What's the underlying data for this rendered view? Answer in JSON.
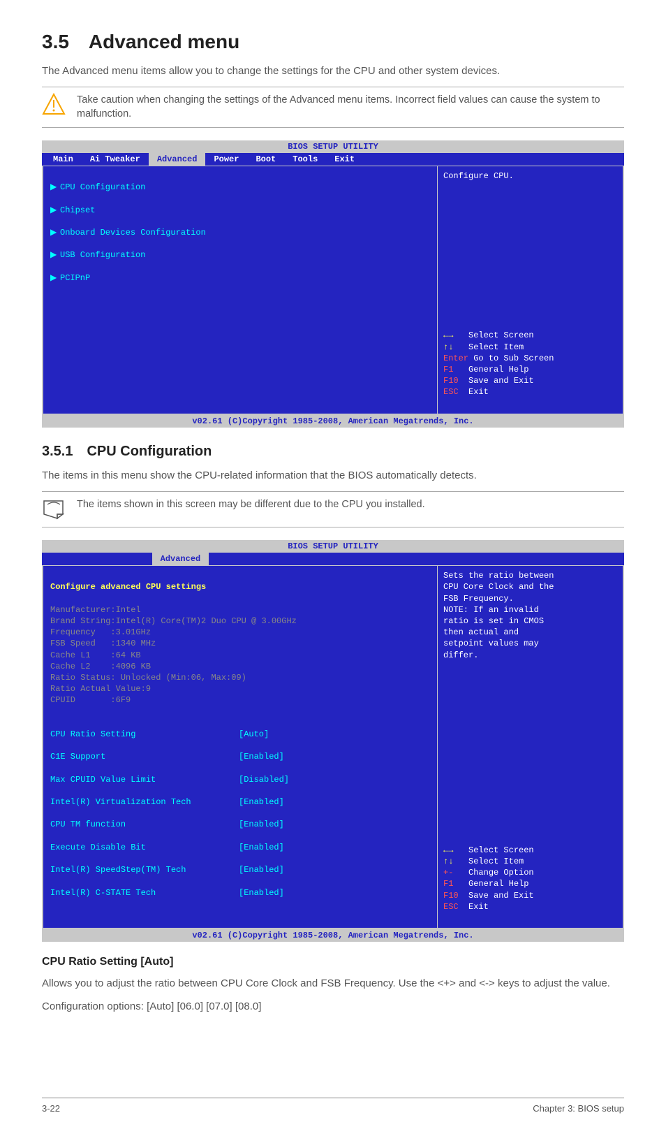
{
  "section_title": "3.5 Advanced menu",
  "intro_text": "The Advanced menu items allow you to change the settings for the CPU and other system devices.",
  "callout1": "Take caution when changing the settings of the Advanced menu items. Incorrect field values can cause the system to malfunction.",
  "bios_header": "BIOS SETUP UTILITY",
  "tabs": {
    "main": "Main",
    "ai": "Ai Tweaker",
    "advanced": "Advanced",
    "power": "Power",
    "boot": "Boot",
    "tools": "Tools",
    "exit": "Exit"
  },
  "menu1_items": {
    "i1": "CPU Configuration",
    "i2": "Chipset",
    "i3": "Onboard Devices Configuration",
    "i4": "USB Configuration",
    "i5": "PCIPnP"
  },
  "menu1_help": "Configure CPU.",
  "keys": {
    "select_screen": "Select Screen",
    "select_item": "Select Item",
    "sub_screen": "Go to Sub Screen",
    "general_help": "General Help",
    "save_exit": "Save and Exit",
    "exit": "Exit",
    "change_option": "Change Option",
    "arrows_lr": "←→",
    "arrows_ud": "↑↓",
    "enter": "Enter",
    "plus_minus": "+-",
    "f1": "F1",
    "f10": "F10",
    "esc": "ESC"
  },
  "bios_footer": "v02.61 (C)Copyright 1985-2008, American Megatrends, Inc.",
  "subsection_title": "3.5.1 CPU Configuration",
  "sub_text": "The items in this menu show the CPU-related information that the BIOS automatically detects.",
  "callout2": "The items shown in this screen may be different due to the CPU you installed.",
  "cpu_heading": "Configure advanced CPU settings",
  "cpu_grey": "Manufacturer:Intel\nBrand String:Intel(R) Core(TM)2 Duo CPU @ 3.00GHz\nFrequency   :3.01GHz\nFSB Speed   :1340 MHz\nCache L1    :64 KB\nCache L2    :4096 KB\nRatio Status: Unlocked (Min:06, Max:09)\nRatio Actual Value:9\nCPUID       :6F9",
  "cpu_settings": {
    "s1l": "CPU Ratio Setting",
    "s1v": "[Auto]",
    "s2l": "C1E Support",
    "s2v": "[Enabled]",
    "s3l": "Max CPUID Value Limit",
    "s3v": "[Disabled]",
    "s4l": "Intel(R) Virtualization Tech",
    "s4v": "[Enabled]",
    "s5l": "CPU TM function",
    "s5v": "[Enabled]",
    "s6l": "Execute Disable Bit",
    "s6v": "[Enabled]",
    "s7l": "Intel(R) SpeedStep(TM) Tech",
    "s7v": "[Enabled]",
    "s8l": "Intel(R) C-STATE Tech",
    "s8v": "[Enabled]"
  },
  "cpu_help": "Sets the ratio between\nCPU Core Clock and the\nFSB Frequency.\nNOTE: If an invalid\nratio is set in CMOS\nthen actual and\nsetpoint values may\ndiffer.",
  "cpu_ratio_heading": "CPU Ratio Setting [Auto]",
  "cpu_ratio_p1": "Allows you to adjust the ratio between CPU Core Clock and FSB Frequency. Use the <+> and <-> keys to adjust the value.",
  "cpu_ratio_p2": "Configuration options: [Auto] [06.0] [07.0] [08.0]",
  "footer_left": "3-22",
  "footer_right": "Chapter 3: BIOS setup"
}
